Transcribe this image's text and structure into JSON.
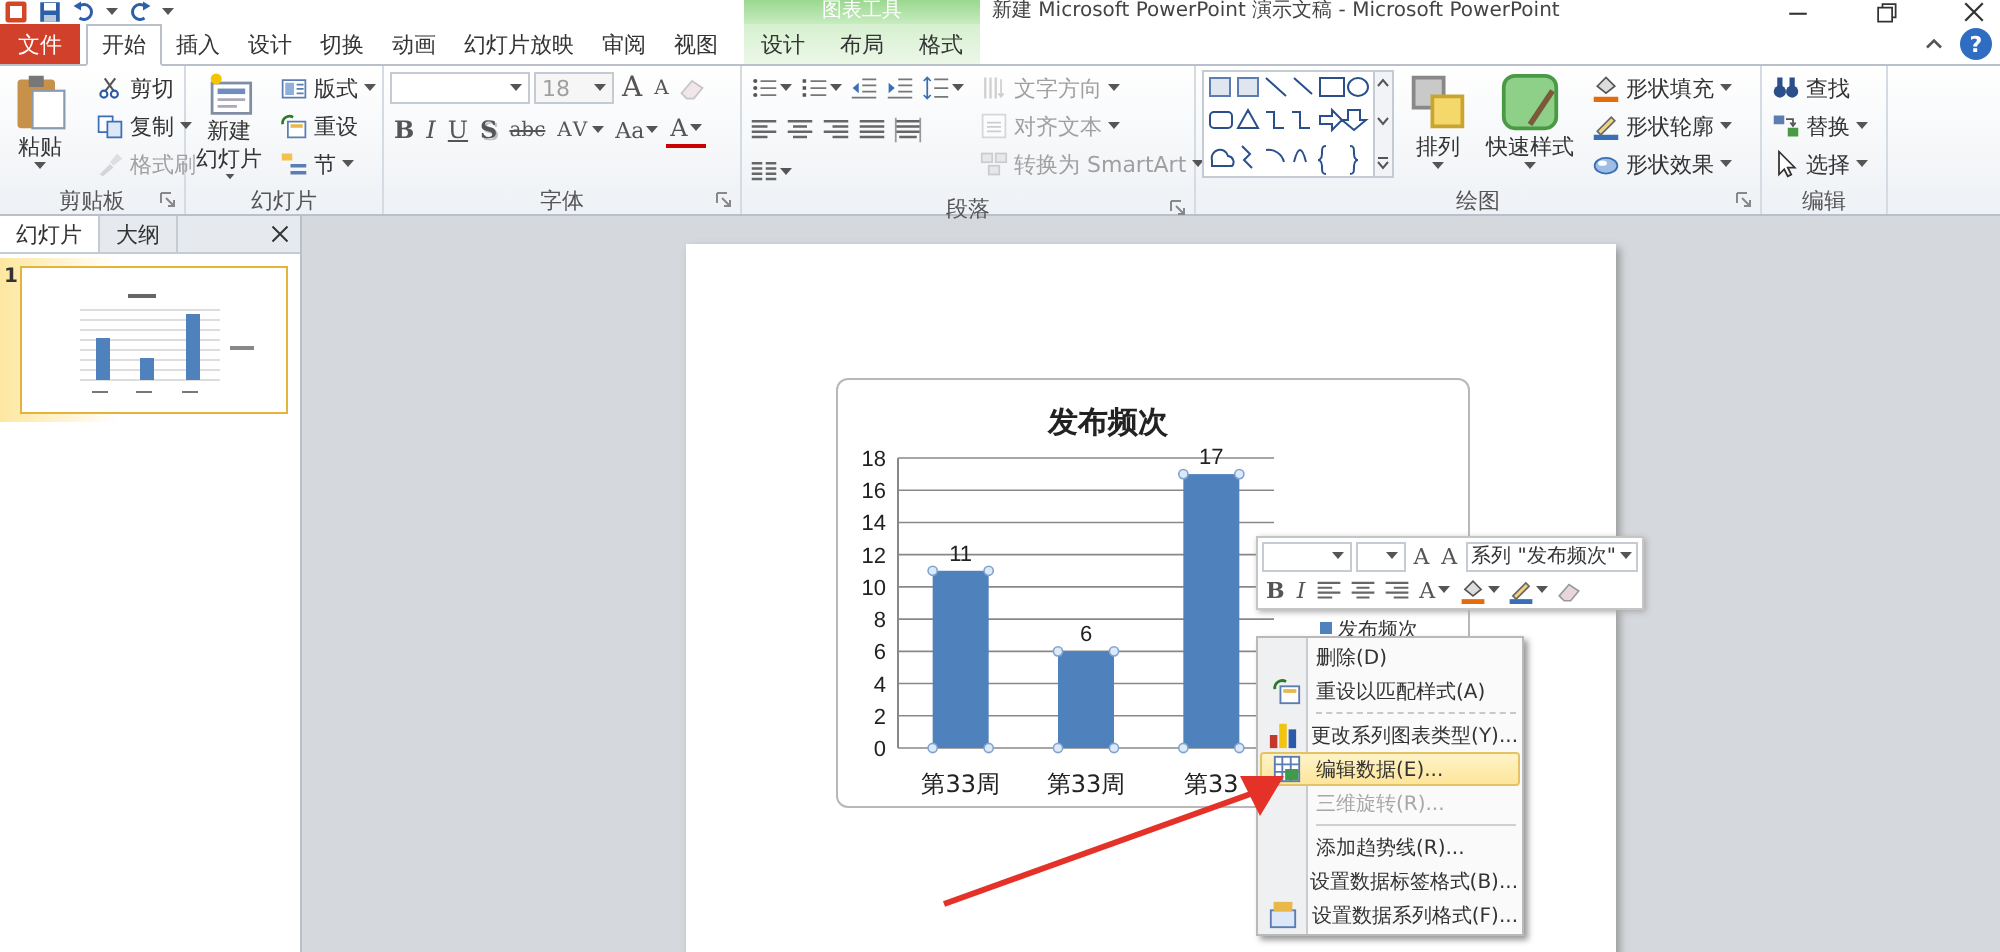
{
  "title_bar": {
    "title": "新建 Microsoft PowerPoint 演示文稿  -  Microsoft PowerPoint",
    "context_header": "图表工具",
    "help": "?"
  },
  "tabs": [
    {
      "label": "文件",
      "kind": "file",
      "selected": false
    },
    {
      "label": "开始",
      "kind": "main",
      "selected": true
    },
    {
      "label": "插入",
      "kind": "main",
      "selected": false
    },
    {
      "label": "设计",
      "kind": "main",
      "selected": false
    },
    {
      "label": "切换",
      "kind": "main",
      "selected": false
    },
    {
      "label": "动画",
      "kind": "main",
      "selected": false
    },
    {
      "label": "幻灯片放映",
      "kind": "main",
      "selected": false
    },
    {
      "label": "审阅",
      "kind": "main",
      "selected": false
    },
    {
      "label": "视图",
      "kind": "main",
      "selected": false
    },
    {
      "label": "设计",
      "kind": "context",
      "selected": false
    },
    {
      "label": "布局",
      "kind": "context",
      "selected": false
    },
    {
      "label": "格式",
      "kind": "context",
      "selected": false
    }
  ],
  "ribbon_groups": [
    {
      "label": "剪贴板",
      "launcher": true,
      "columns": [
        {
          "controls": [
            {
              "kind": "large",
              "label": "粘贴",
              "dropdown": true,
              "disabled": false
            }
          ]
        },
        {
          "controls": [
            {
              "kind": "small",
              "label": "剪切",
              "dropdown": false,
              "disabled": false
            },
            {
              "kind": "small",
              "label": "复制",
              "dropdown": true,
              "disabled": false
            },
            {
              "kind": "small",
              "label": "格式刷",
              "dropdown": false,
              "disabled": true
            }
          ]
        }
      ]
    },
    {
      "label": "幻灯片",
      "launcher": false,
      "columns": [
        {
          "controls": [
            {
              "kind": "large",
              "lines": [
                "新建",
                "幻灯片"
              ],
              "dropdown": true,
              "disabled": false
            }
          ]
        },
        {
          "controls": [
            {
              "kind": "small",
              "label": "版式",
              "dropdown": true,
              "disabled": false
            },
            {
              "kind": "small",
              "label": "重设",
              "dropdown": false,
              "disabled": false
            },
            {
              "kind": "small",
              "label": "节",
              "dropdown": true,
              "disabled": false
            }
          ]
        }
      ]
    },
    {
      "label": "字体",
      "launcher": true,
      "columns": [
        {
          "controls": [
            {
              "kind": "row",
              "items": [
                {
                  "kind": "field",
                  "dropdown": true,
                  "disabled": false
                },
                {
                  "kind": "field",
                  "value": "18",
                  "dropdown": true,
                  "disabled": true
                },
                {
                  "kind": "glyph",
                  "label": "A",
                  "dropdown": false
                },
                {
                  "kind": "glyph",
                  "label": "A",
                  "dropdown": false
                },
                {
                  "kind": "icon",
                  "dropdown": false,
                  "disabled": true
                }
              ]
            },
            {
              "kind": "row",
              "items": [
                {
                  "kind": "glyph",
                  "label": "B",
                  "dropdown": false
                },
                {
                  "kind": "glyph",
                  "label": "I",
                  "dropdown": false
                },
                {
                  "kind": "glyph",
                  "label": "U",
                  "dropdown": false
                },
                {
                  "kind": "glyph",
                  "label": "S",
                  "dropdown": false
                },
                {
                  "kind": "glyph",
                  "label": "abc",
                  "dropdown": false
                },
                {
                  "kind": "glyph",
                  "label": "AV",
                  "dropdown": true
                },
                {
                  "kind": "glyph",
                  "label": "Aa",
                  "dropdown": true
                },
                {
                  "kind": "glyph",
                  "label": "A",
                  "dropdown": true
                }
              ]
            }
          ]
        }
      ]
    },
    {
      "label": "段落",
      "launcher": true,
      "columns": [
        {
          "controls": [
            {
              "kind": "row",
              "items": [
                {
                  "kind": "icon",
                  "dropdown": true,
                  "disabled": false
                },
                {
                  "kind": "icon",
                  "dropdown": true,
                  "disabled": false
                },
                {
                  "kind": "icon",
                  "dropdown": false,
                  "disabled": false
                },
                {
                  "kind": "icon",
                  "dropdown": false,
                  "disabled": false
                },
                {
                  "kind": "icon",
                  "dropdown": true,
                  "disabled": false
                }
              ]
            },
            {
              "kind": "row",
              "items": [
                {
                  "kind": "icon",
                  "dropdown": false,
                  "disabled": false
                },
                {
                  "kind": "icon",
                  "dropdown": false,
                  "disabled": false
                },
                {
                  "kind": "icon",
                  "dropdown": false,
                  "disabled": false
                },
                {
                  "kind": "icon",
                  "dropdown": false,
                  "disabled": false
                },
                {
                  "kind": "icon",
                  "dropdown": false,
                  "disabled": false
                }
              ]
            },
            {
              "kind": "row",
              "items": [
                {
                  "kind": "icon",
                  "dropdown": true,
                  "disabled": false
                }
              ]
            }
          ]
        },
        {
          "controls": [
            {
              "kind": "small",
              "label": "文字方向",
              "dropdown": true,
              "disabled": true
            },
            {
              "kind": "small",
              "label": "对齐文本",
              "dropdown": true,
              "disabled": true
            },
            {
              "kind": "small",
              "label": "转换为 SmartArt",
              "dropdown": true,
              "disabled": true
            }
          ]
        }
      ]
    },
    {
      "label": "绘图",
      "launcher": true,
      "columns": [
        {
          "controls": [
            {
              "kind": "gallery"
            }
          ]
        },
        {
          "controls": [
            {
              "kind": "large",
              "label": "排列",
              "dropdown": true,
              "disabled": false
            }
          ]
        },
        {
          "controls": [
            {
              "kind": "large",
              "label": "快速样式",
              "dropdown": true,
              "disabled": false
            }
          ]
        },
        {
          "controls": [
            {
              "kind": "small",
              "label": "形状填充",
              "dropdown": true,
              "disabled": false
            },
            {
              "kind": "small",
              "label": "形状轮廓",
              "dropdown": true,
              "disabled": false
            },
            {
              "kind": "small",
              "label": "形状效果",
              "dropdown": true,
              "disabled": false
            }
          ]
        }
      ]
    },
    {
      "label": "编辑",
      "launcher": false,
      "columns": [
        {
          "controls": [
            {
              "kind": "small",
              "label": "查找",
              "dropdown": false,
              "disabled": false
            },
            {
              "kind": "small",
              "label": "替换",
              "dropdown": true,
              "disabled": false
            },
            {
              "kind": "small",
              "label": "选择",
              "dropdown": true,
              "disabled": false
            }
          ]
        }
      ]
    }
  ],
  "slides_pane": {
    "tabs": [
      {
        "label": "幻灯片",
        "selected": true
      },
      {
        "label": "大纲",
        "selected": false
      }
    ],
    "slides": [
      {
        "number": "1",
        "selected": true
      }
    ]
  },
  "chart": {
    "chart_data": {
      "type": "bar",
      "title": "发布频次",
      "categories": [
        "第33周",
        "第33周",
        "第33"
      ],
      "series": [
        {
          "name": "发布频次",
          "color": "#4f81bd",
          "values": [
            11,
            6,
            17
          ]
        }
      ],
      "ylim": [
        0,
        18
      ],
      "yticks": [
        0,
        2,
        4,
        6,
        8,
        10,
        12,
        14,
        16,
        18
      ],
      "grid": true,
      "data_labels": true
    }
  },
  "mini_toolbar": {
    "rows": [
      {
        "items": [
          {
            "kind": "field",
            "dropdown": true
          },
          {
            "kind": "field",
            "dropdown": true
          },
          {
            "kind": "glyph",
            "label": "A",
            "dropdown": false
          },
          {
            "kind": "glyph",
            "label": "A",
            "dropdown": false
          },
          {
            "kind": "select",
            "label": "系列 \"发布频次\"",
            "dropdown": true
          }
        ]
      },
      {
        "items": [
          {
            "kind": "glyph",
            "label": "B",
            "dropdown": false
          },
          {
            "kind": "glyph",
            "label": "I",
            "dropdown": false
          },
          {
            "kind": "icon",
            "dropdown": false
          },
          {
            "kind": "icon",
            "dropdown": false
          },
          {
            "kind": "icon",
            "dropdown": false
          },
          {
            "kind": "glyph",
            "label": "A",
            "dropdown": true
          },
          {
            "kind": "icon",
            "dropdown": true
          },
          {
            "kind": "icon",
            "dropdown": true
          },
          {
            "kind": "icon",
            "dropdown": false
          }
        ]
      }
    ]
  },
  "context_menu": {
    "items": [
      {
        "label": "删除(D)",
        "disabled": false,
        "selected": false,
        "separator_after": false
      },
      {
        "label": "重设以匹配样式(A)",
        "disabled": false,
        "selected": false,
        "separator_after": true
      },
      {
        "label": "更改系列图表类型(Y)...",
        "disabled": false,
        "selected": false,
        "separator_after": false
      },
      {
        "label": "编辑数据(E)...",
        "disabled": false,
        "selected": true,
        "separator_after": false
      },
      {
        "label": "三维旋转(R)...",
        "disabled": true,
        "selected": false,
        "separator_after": true
      },
      {
        "label": "添加趋势线(R)...",
        "disabled": false,
        "selected": false,
        "separator_after": false
      },
      {
        "label": "设置数据标签格式(B)...",
        "disabled": false,
        "selected": false,
        "separator_after": false
      },
      {
        "label": "设置数据系列格式(F)...",
        "disabled": false,
        "selected": false,
        "separator_after": false
      }
    ]
  }
}
